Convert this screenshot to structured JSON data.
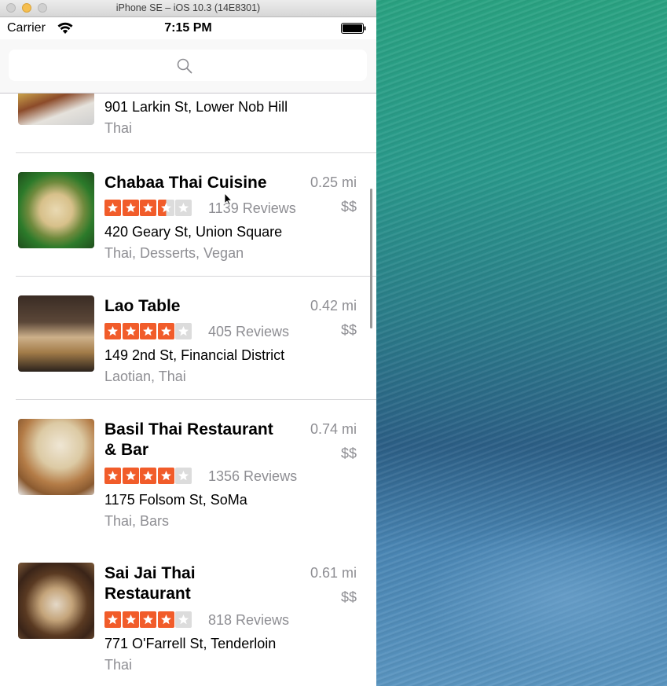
{
  "window": {
    "title": "iPhone SE – iOS 10.3 (14E8301)"
  },
  "status_bar": {
    "carrier": "Carrier",
    "time": "7:15 PM"
  },
  "search": {
    "placeholder": "",
    "value": ""
  },
  "colors": {
    "star_active": "#f15c2a",
    "star_inactive": "#dcdcdc",
    "secondary_text": "#8e8e93"
  },
  "restaurants": [
    {
      "name": "",
      "distance": "",
      "price": "",
      "rating": null,
      "reviews": "",
      "address": "901 Larkin St, Lower Nob Hill",
      "categories": "Thai"
    },
    {
      "name": "Chabaa Thai Cuisine",
      "distance": "0.25 mi",
      "price": "$$",
      "rating": 3.5,
      "reviews": "1139 Reviews",
      "address": "420 Geary St, Union Square",
      "categories": "Thai, Desserts, Vegan"
    },
    {
      "name": "Lao Table",
      "distance": "0.42 mi",
      "price": "$$",
      "rating": 4,
      "reviews": "405 Reviews",
      "address": "149 2nd St, Financial District",
      "categories": "Laotian, Thai"
    },
    {
      "name": "Basil Thai Restaurant & Bar",
      "name_line1": "Basil Thai Restaurant",
      "name_line2": "& Bar",
      "distance": "0.74 mi",
      "price": "$$",
      "rating": 4,
      "reviews": "1356 Reviews",
      "address": "1175 Folsom St, SoMa",
      "categories": "Thai, Bars"
    },
    {
      "name": "Sai Jai Thai Restaurant",
      "name_line1": "Sai Jai Thai",
      "name_line2": "Restaurant",
      "distance": "0.61 mi",
      "price": "$$",
      "rating": 4,
      "reviews": "818 Reviews",
      "address": "771 O'Farrell St, Tenderloin",
      "categories": "Thai"
    }
  ]
}
